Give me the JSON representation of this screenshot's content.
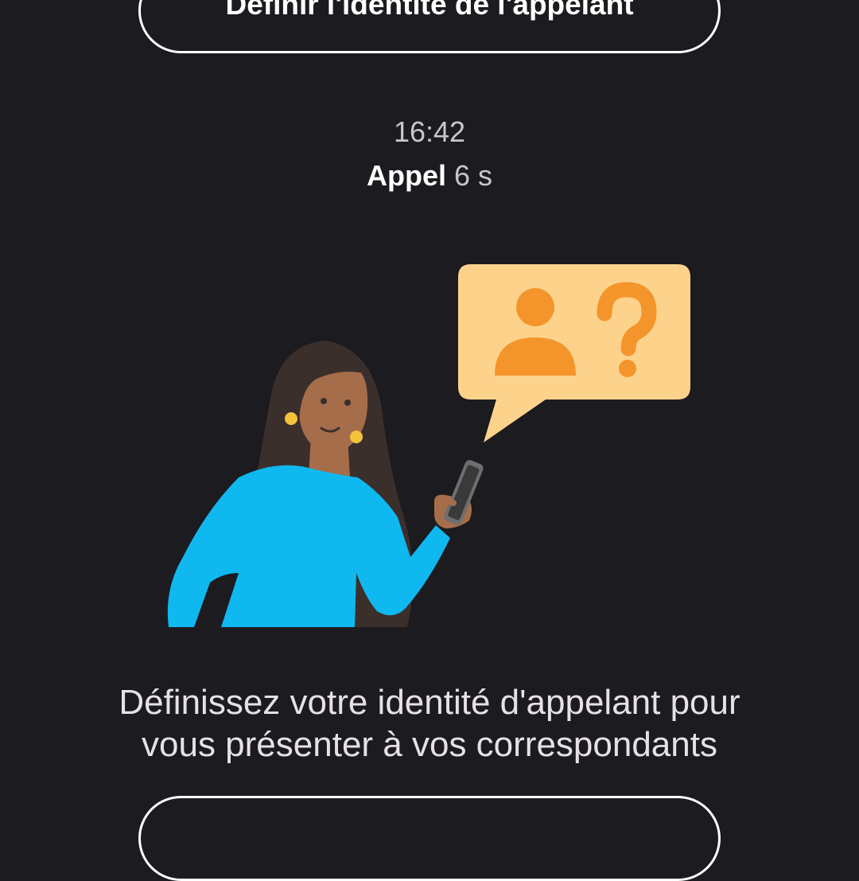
{
  "top_button": {
    "label": "Définir l'identité de l'appelant"
  },
  "call": {
    "time": "16:42",
    "type": "Appel",
    "duration": "6 s"
  },
  "illustration": {
    "icons": [
      "person-icon",
      "question-mark-icon",
      "chat-bubble-icon",
      "woman-with-phone-illustration"
    ],
    "colors": {
      "bubble": "#fdd38c",
      "accent_orange": "#f4952b",
      "shirt": "#0fb8ef",
      "hair": "#3b2f2c",
      "skin": "#a66d4b",
      "earring": "#f5c23c"
    }
  },
  "message": {
    "line1": "Définissez votre identité d'appelant pour",
    "line2": "vous présenter à vos correspondants"
  },
  "bottom_button": {
    "label": ""
  },
  "theme": {
    "background": "#1c1b1f",
    "text": "#e6e1e5",
    "border": "#ffffff"
  }
}
